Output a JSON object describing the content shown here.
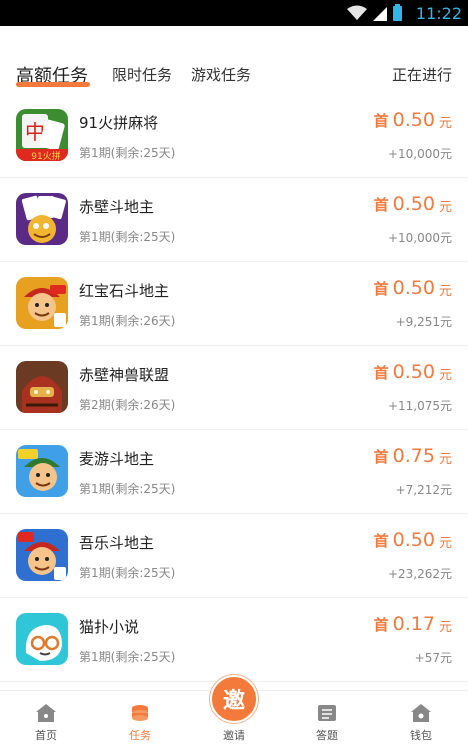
{
  "status_bar": {
    "time": "11:22"
  },
  "tabs": {
    "items": [
      {
        "label": "高额任务"
      },
      {
        "label": "限时任务"
      },
      {
        "label": "游戏任务"
      }
    ],
    "right_label": "正在进行"
  },
  "tasks": [
    {
      "name": "91火拼麻将",
      "sub": "第1期(剩余:25天)",
      "badge": "首",
      "price": "0.50",
      "unit": "元",
      "total": "+10,000元",
      "icon": "mahjong-game-icon"
    },
    {
      "name": "赤壁斗地主",
      "sub": "第1期(剩余:25天)",
      "badge": "首",
      "price": "0.50",
      "unit": "元",
      "total": "+10,000元",
      "icon": "poker-card-icon"
    },
    {
      "name": "红宝石斗地主",
      "sub": "第1期(剩余:26天)",
      "badge": "首",
      "price": "0.50",
      "unit": "元",
      "total": "+9,251元",
      "icon": "cartoon-farmer-icon"
    },
    {
      "name": "赤壁神兽联盟",
      "sub": "第2期(剩余:26天)",
      "badge": "首",
      "price": "0.50",
      "unit": "元",
      "total": "+11,075元",
      "icon": "warrior-helmet-icon"
    },
    {
      "name": "麦游斗地主",
      "sub": "第1期(剩余:25天)",
      "badge": "首",
      "price": "0.75",
      "unit": "元",
      "total": "+7,212元",
      "icon": "cartoon-farmer-icon"
    },
    {
      "name": "吾乐斗地主",
      "sub": "第1期(剩余:25天)",
      "badge": "首",
      "price": "0.50",
      "unit": "元",
      "total": "+23,262元",
      "icon": "cartoon-farmer-icon"
    },
    {
      "name": "猫扑小说",
      "sub": "第1期(剩余:25天)",
      "badge": "首",
      "price": "0.17",
      "unit": "元",
      "total": "+57元",
      "icon": "glasses-face-icon"
    }
  ],
  "bottom_nav": {
    "home": "首页",
    "tasks": "任务",
    "invite_circle": "邀",
    "invite": "邀请",
    "quiz": "答题",
    "wallet": "钱包"
  },
  "colors": {
    "accent": "#f47a3c",
    "status_blue": "#33b5e5"
  }
}
